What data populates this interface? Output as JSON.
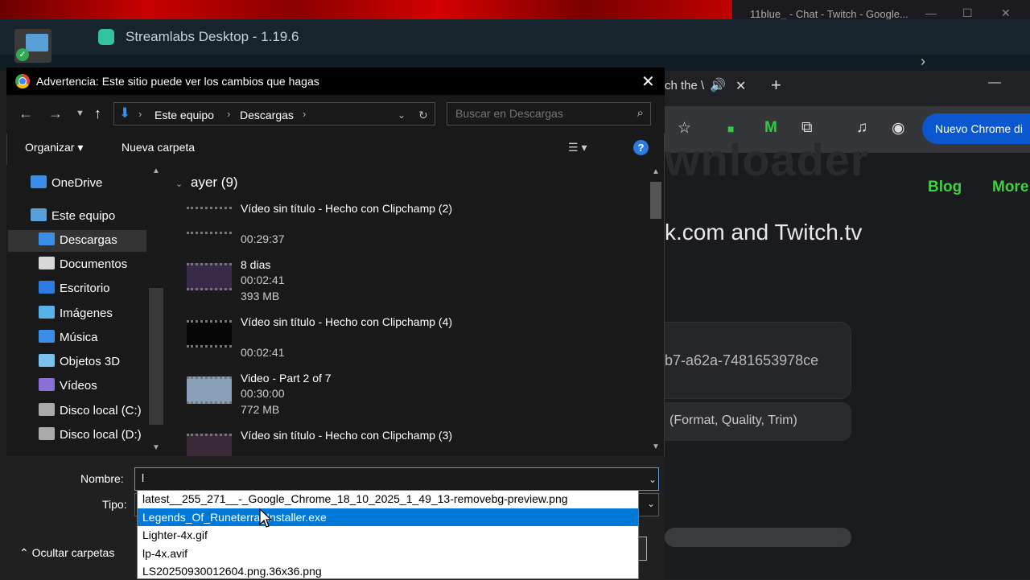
{
  "twitch_window": {
    "title": "11blue_ - Chat - Twitch - Google..."
  },
  "streamlabs": {
    "title": "Streamlabs Desktop - 1.19.6"
  },
  "background_chrome": {
    "tab_fragment": "ch the \\",
    "button": "Nuevo Chrome di",
    "heading_ghost": "wnloader",
    "nav": [
      "Blog",
      "More"
    ],
    "subtitle": "k.com and Twitch.tv",
    "uuid": "b7-a62a-7481653978ce",
    "options": "(Format, Quality, Trim)"
  },
  "dialog": {
    "title": "Advertencia: Este sitio puede ver los cambios que hagas",
    "breadcrumb": [
      "Este equipo",
      "Descargas"
    ],
    "search_placeholder": "Buscar en Descargas",
    "commands": {
      "organize": "Organizar ▾",
      "new_folder": "Nueva carpeta"
    },
    "sidebar": [
      {
        "label": "OneDrive",
        "icon": "cloud-icon",
        "color": "#3a8ee6"
      },
      {
        "label": "Este equipo",
        "icon": "pc-icon",
        "color": "#5aa0d8"
      },
      {
        "label": "Descargas",
        "icon": "download-icon",
        "color": "#3a8ee6"
      },
      {
        "label": "Documentos",
        "icon": "document-icon",
        "color": "#d8d8d8"
      },
      {
        "label": "Escritorio",
        "icon": "desktop-icon",
        "color": "#2d7be0"
      },
      {
        "label": "Imágenes",
        "icon": "pictures-icon",
        "color": "#5ab0e8"
      },
      {
        "label": "Música",
        "icon": "music-icon",
        "color": "#3a8ee6"
      },
      {
        "label": "Objetos 3D",
        "icon": "cube-icon",
        "color": "#7ac0f0"
      },
      {
        "label": "Vídeos",
        "icon": "video-icon",
        "color": "#8a6fd8"
      },
      {
        "label": "Disco local (C:)",
        "icon": "drive-icon",
        "color": "#aaaaaa"
      },
      {
        "label": "Disco local (D:)",
        "icon": "drive-icon",
        "color": "#aaaaaa"
      }
    ],
    "group_header": "ayer (9)",
    "files": [
      {
        "name": "Vídeo sin título - Hecho con Clipchamp (2)",
        "meta1": "00:29:37",
        "meta2": ""
      },
      {
        "name": "8 dias",
        "meta1": "00:02:41",
        "meta2": "393 MB"
      },
      {
        "name": "Vídeo sin título - Hecho con Clipchamp (4)",
        "meta1": "00:02:41",
        "meta2": ""
      },
      {
        "name": "Video - Part 2 of 7",
        "meta1": "00:30:00",
        "meta2": "772 MB"
      },
      {
        "name": "Vídeo sin título - Hecho con Clipchamp (3)",
        "meta1": "",
        "meta2": ""
      }
    ],
    "name_label": "Nombre:",
    "name_value": "l",
    "type_label": "Tipo:",
    "hide_folders": "Ocultar carpetas",
    "autocomplete": [
      "latest__255_271__-_Google_Chrome_18_10_2025_1_49_13-removebg-preview.png",
      "Legends_Of_Runeterra_Installer.exe",
      "Lighter-4x.gif",
      "lp-4x.avif",
      "LS20250930012604.png.36x36.png"
    ],
    "autocomplete_selected_index": 1
  }
}
